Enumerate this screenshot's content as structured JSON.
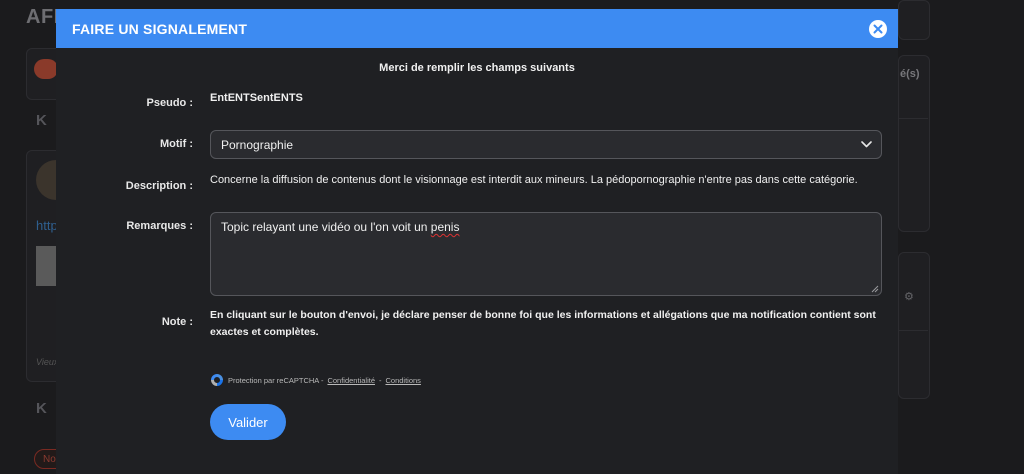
{
  "background": {
    "page_title": "AFF",
    "k_initial_1": "K",
    "k_initial_2": "K",
    "link_fragment": "http",
    "caption_fragment": "Vieux",
    "side_label": "é(s)",
    "pill_1": "No",
    "pill_2": ""
  },
  "modal": {
    "title": "FAIRE UN SIGNALEMENT",
    "intro": "Merci de remplir les champs suivants",
    "pseudo_label": "Pseudo :",
    "pseudo_value": "EntENTSentENTS",
    "motif_label": "Motif :",
    "motif_selected": "Pornographie",
    "description_label": "Description :",
    "description_text": "Concerne la diffusion de contenus dont le visionnage est interdit aux mineurs. La pédopornographie n'entre pas dans cette catégorie.",
    "remarques_label": "Remarques :",
    "remarques_text_before": "Topic relayant une vidéo ou l'on voit un ",
    "remarques_text_misspelled": "penis",
    "note_label": "Note :",
    "note_text": "En cliquant sur le bouton d'envoi, je déclare penser de bonne foi que les informations et allégations que ma notification contient sont exactes et complètes.",
    "recaptcha_text": "Protection par reCAPTCHA -",
    "recaptcha_privacy": "Confidentialité",
    "recaptcha_sep": "-",
    "recaptcha_terms": "Conditions",
    "submit_label": "Valider"
  },
  "colors": {
    "accent": "#3d8bf2",
    "modal_bg": "#1f2023",
    "field_bg": "#2a2b2f",
    "page_bg": "#1b1b1d"
  },
  "icons": {
    "close": "close-circle-icon",
    "dropdown": "chevron-down-icon",
    "recaptcha": "recaptcha-logo-icon",
    "resize": "resize-handle-icon"
  }
}
